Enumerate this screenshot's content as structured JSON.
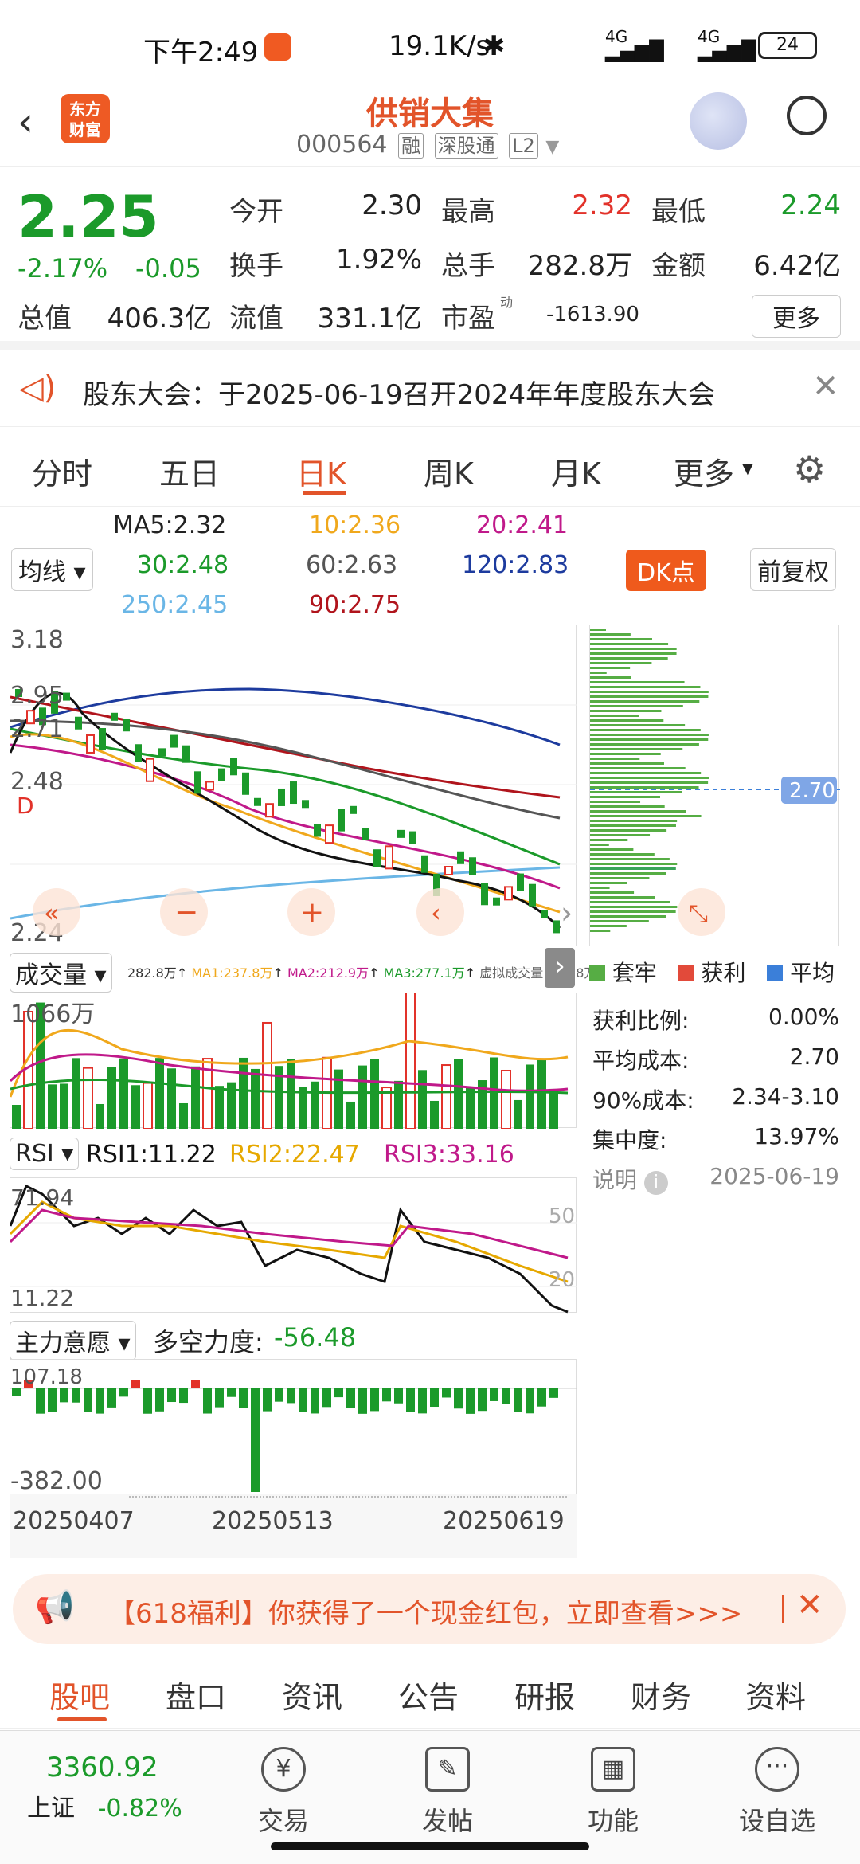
{
  "status": {
    "time": "下午2:49",
    "speed": "19.1K/s",
    "net1": "4G",
    "net2": "4G",
    "battery": "24"
  },
  "header": {
    "title": "供销大集",
    "code": "000564",
    "tag1": "融",
    "tag2": "深股通",
    "tag3": "L2",
    "logo_line1": "东方",
    "logo_line2": "财富"
  },
  "quote": {
    "price": "2.25",
    "change_pct": "-2.17%",
    "change": "-0.05",
    "open_label": "今开",
    "open": "2.30",
    "high_label": "最高",
    "high": "2.32",
    "low_label": "最低",
    "low": "2.24",
    "turnover_label": "换手",
    "turnover": "1.92%",
    "volume_label": "总手",
    "volume": "282.8万",
    "amount_label": "金额",
    "amount": "6.42亿",
    "mktcap_label": "总值",
    "mktcap": "406.3亿",
    "float_label": "流值",
    "float": "331.1亿",
    "pe_label": "市盈",
    "pe_sup": "动",
    "pe": "-1613.90",
    "more": "更多"
  },
  "notice": {
    "text": "股东大会：于2025-06-19召开2024年年度股东大会"
  },
  "tabs": [
    "分时",
    "五日",
    "日K",
    "周K",
    "月K",
    "更多"
  ],
  "ma": {
    "ma5": "MA5:2.32",
    "ma10": "10:2.36",
    "ma20": "20:2.41",
    "ma30": "30:2.48",
    "ma60": "60:2.63",
    "ma120": "120:2.83",
    "ma250": "250:2.45",
    "ma90": "90:2.75",
    "selector": "均线",
    "dk": "DK点",
    "adjust": "前复权"
  },
  "kline": {
    "y_top": "3.18",
    "y_2": "2.95",
    "y_3": "2.71",
    "y_4": "2.48",
    "y_bottom": "2.24",
    "marker": "D",
    "chip_price": "2.70"
  },
  "volume": {
    "selector": "成交量",
    "v": "282.8万",
    "ma1": "MA1:237.8万",
    "ma2": "MA2:212.9万",
    "ma3": "MA3:277.1万",
    "virtual": "虚拟成交量:291.8万",
    "y_top": "1066万"
  },
  "rsi": {
    "selector": "RSI",
    "rsi1": "RSI1:11.22",
    "rsi2": "RSI2:22.47",
    "rsi3": "RSI3:33.16",
    "y_top": "71.94",
    "y_bottom": "11.22",
    "l50": "50",
    "l20": "20"
  },
  "main_force": {
    "selector": "主力意愿",
    "label": "多空力度:",
    "value": "-56.48",
    "y_top": "107.18",
    "y_bottom": "-382.00"
  },
  "dates": {
    "d1": "20250407",
    "d2": "20250513",
    "d3": "20250619"
  },
  "chip": {
    "leg1": "套牢",
    "leg2": "获利",
    "leg3": "平均",
    "rows": [
      {
        "k": "获利比例:",
        "v": "0.00%"
      },
      {
        "k": "平均成本:",
        "v": "2.70"
      },
      {
        "k": "90%成本:",
        "v": "2.34-3.10"
      },
      {
        "k": "集中度:",
        "v": "13.97%"
      }
    ],
    "note": "说明",
    "date": "2025-06-19"
  },
  "promo": {
    "text": "【618福利】你获得了一个现金红包，立即查看>>>"
  },
  "nav": [
    "股吧",
    "盘口",
    "资讯",
    "公告",
    "研报",
    "财务",
    "资料"
  ],
  "bottom": {
    "index_value": "3360.92",
    "index_name": "上证",
    "index_change": "-0.82%",
    "items": [
      "交易",
      "发帖",
      "功能",
      "设自选"
    ]
  },
  "colors": {
    "accent": "#e2542a",
    "up": "#e2322a",
    "down": "#1b9a2a"
  }
}
